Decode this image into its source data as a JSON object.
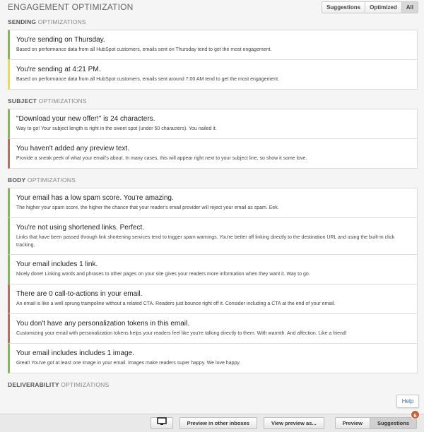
{
  "header": {
    "title": "ENGAGEMENT OPTIMIZATION",
    "filters": [
      "Suggestions",
      "Optimized",
      "All"
    ]
  },
  "sections": [
    {
      "title_bold": "SENDING",
      "title_rest": " OPTIMIZATIONS",
      "items": [
        {
          "title": "You're sending on Thursday.",
          "desc": "Based on performance data from all HubSpot customers, emails sent on Thursday tend to get the most engagement.",
          "status": "green"
        },
        {
          "title": "You're sending at 4:21 PM.",
          "desc": "Based on performance data from all HubSpot customers, emails sent around 7:00 AM tend to get the most engagement.",
          "status": "yellow"
        }
      ]
    },
    {
      "title_bold": "SUBJECT",
      "title_rest": " OPTIMIZATIONS",
      "items": [
        {
          "title": "\"Download your new offer!\" is 24 characters.",
          "desc": "Way to go! Your subject length is right in the sweet spot (under 50 characters). You nailed it.",
          "status": "green"
        },
        {
          "title": "You haven't added any preview text.",
          "desc": "Provide a sneak peek of what your email's about. In many cases, this will appear right next to your subject line, so show it some love.",
          "status": "red"
        }
      ]
    },
    {
      "title_bold": "BODY",
      "title_rest": " OPTIMIZATIONS",
      "items": [
        {
          "title": "Your email has a low spam score. You're amazing.",
          "desc": "The higher your spam score, the higher the chance that your reader's email provider will reject your email as spam. Eek.",
          "status": "green"
        },
        {
          "title": "You're not using shortened links. Perfect.",
          "desc": "Links that have been passed through link shortening services tend to trigger spam warnings. You're better off linking directly to the destination URL and using the built-in click tracking.",
          "status": "green"
        },
        {
          "title": "Your email includes 1 link.",
          "desc": "Nicely done! Linking words and phrases to other pages on your site gives your readers more information when they want it. Way to go.",
          "status": "green"
        },
        {
          "title": "There are 0 call-to-actions in your email.",
          "desc": "An email is like a well sprung trampoline without a related CTA. Readers just bounce right off it. Consider including a CTA at the end of your email.",
          "status": "red"
        },
        {
          "title": "You don't have any personalization tokens in this email.",
          "desc": "Customizing your email with personalization tokens helps your readers feel like you're talking directly to them. With warmth. And affection. Like a friend!",
          "status": "red"
        },
        {
          "title": "Your email includes includes 1 image.",
          "desc": "Great! You've got at least one image in your email. Images make readers super happy. We love happy.",
          "status": "green"
        }
      ]
    },
    {
      "title_bold": "DELIVERABILITY",
      "title_rest": " OPTIMIZATIONS",
      "items": []
    }
  ],
  "footer": {
    "preview_inboxes": "Preview in other inboxes",
    "preview_as": "View preview as...",
    "preview": "Preview",
    "suggestions": "Suggestions",
    "suggestions_count": "6"
  },
  "help_label": "Help",
  "colors": {
    "green": "#7cc03f",
    "yellow": "#f2e02d",
    "red": "#c9685a"
  }
}
